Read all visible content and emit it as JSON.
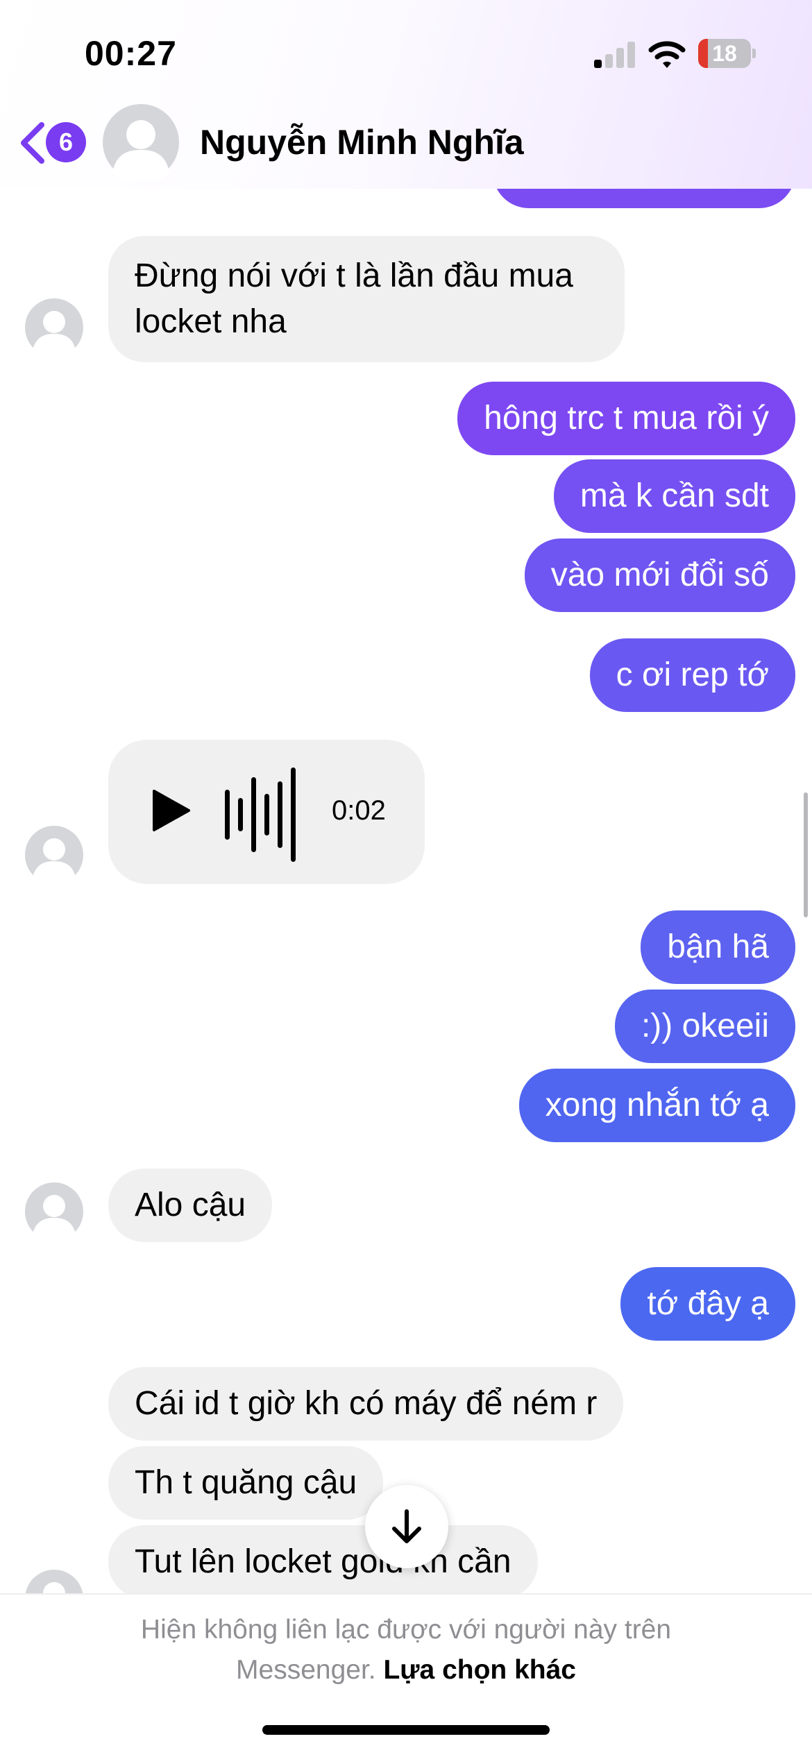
{
  "status_bar": {
    "time": "00:27",
    "battery": "18",
    "battery_level_percent": 18
  },
  "header": {
    "back_badge": "6",
    "contact_name": "Nguyễn Minh Nghĩa"
  },
  "colors": {
    "outgoing_purple": "#7b4cf2",
    "outgoing_blue": "#4f66f0",
    "incoming": "#f0f0f0",
    "accent": "#7a3cf0"
  },
  "messages": {
    "m1": "Đừng nói với t là lần đầu mua locket nha",
    "m2": "hông trc t mua rồi ý",
    "m3": "mà k cần sdt",
    "m4": "vào mới đổi số",
    "m5": "c ơi rep tớ",
    "voice_duration": "0:02",
    "m6": "bận hã",
    "m7": ":)) okeeii",
    "m8": "xong nhắn tớ ạ",
    "m9": "Alo cậu",
    "m10": "tớ đây ạ",
    "m11": "Cái id t giờ kh có máy để ném r",
    "m12": "Th t quăng cậu",
    "m13": "Tut lên locket gold kh cần"
  },
  "footer": {
    "notice": "Hiện không liên lạc được với người này trên Messenger.",
    "link": "Lựa chọn khác"
  }
}
